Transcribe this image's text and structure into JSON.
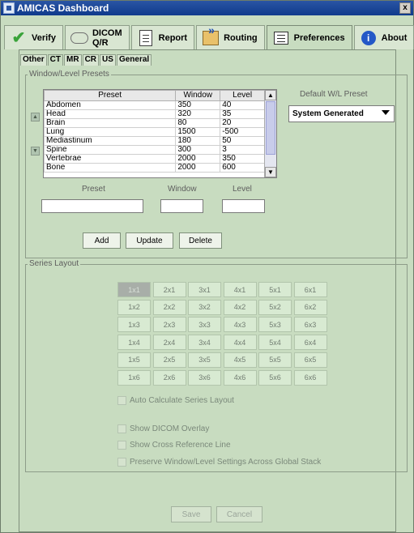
{
  "window": {
    "title": "AMICAS Dashboard",
    "close": "x"
  },
  "main_tabs": [
    {
      "label": "Verify",
      "icon": "check-icon"
    },
    {
      "label": "DICOM Q/R",
      "icon": "glasses-icon"
    },
    {
      "label": "Report",
      "icon": "document-icon"
    },
    {
      "label": "Routing",
      "icon": "routing-icon"
    },
    {
      "label": "Preferences",
      "icon": "preferences-icon",
      "active": true
    },
    {
      "label": "About",
      "icon": "info-icon"
    }
  ],
  "sub_tabs": [
    {
      "label": "Other"
    },
    {
      "label": "CT",
      "active": true
    },
    {
      "label": "MR"
    },
    {
      "label": "CR"
    },
    {
      "label": "US"
    },
    {
      "label": "General"
    }
  ],
  "wl_presets": {
    "group_title": "Window/Level Presets",
    "columns": [
      "Preset",
      "Window",
      "Level"
    ],
    "rows": [
      [
        "Abdomen",
        "350",
        "40"
      ],
      [
        "Head",
        "320",
        "35"
      ],
      [
        "Brain",
        "80",
        "20"
      ],
      [
        "Lung",
        "1500",
        "-500"
      ],
      [
        "Mediastinum",
        "180",
        "50"
      ],
      [
        "Spine",
        "300",
        "3"
      ],
      [
        "Vertebrae",
        "2000",
        "350"
      ],
      [
        "Bone",
        "2000",
        "600"
      ]
    ],
    "form_labels": {
      "preset": "Preset",
      "window": "Window",
      "level": "Level"
    },
    "form_values": {
      "preset": "",
      "window": "",
      "level": ""
    },
    "buttons": {
      "add": "Add",
      "update": "Update",
      "delete": "Delete"
    },
    "default_label": "Default W/L Preset",
    "default_value": "System Generated"
  },
  "series_layout": {
    "group_title": "Series Layout",
    "grid": [
      [
        "1x1",
        "2x1",
        "3x1",
        "4x1",
        "5x1",
        "6x1"
      ],
      [
        "1x2",
        "2x2",
        "3x2",
        "4x2",
        "5x2",
        "6x2"
      ],
      [
        "1x3",
        "2x3",
        "3x3",
        "4x3",
        "5x3",
        "6x3"
      ],
      [
        "1x4",
        "2x4",
        "3x4",
        "4x4",
        "5x4",
        "6x4"
      ],
      [
        "1x5",
        "2x5",
        "3x5",
        "4x5",
        "5x5",
        "6x5"
      ],
      [
        "1x6",
        "2x6",
        "3x6",
        "4x6",
        "5x6",
        "6x6"
      ]
    ],
    "selected": "1x1",
    "auto_calculate": "Auto Calculate Series Layout",
    "options": [
      "Show DICOM Overlay",
      "Show Cross Reference Line",
      "Preserve Window/Level Settings Across Global Stack"
    ]
  },
  "footer": {
    "save": "Save",
    "cancel": "Cancel"
  }
}
